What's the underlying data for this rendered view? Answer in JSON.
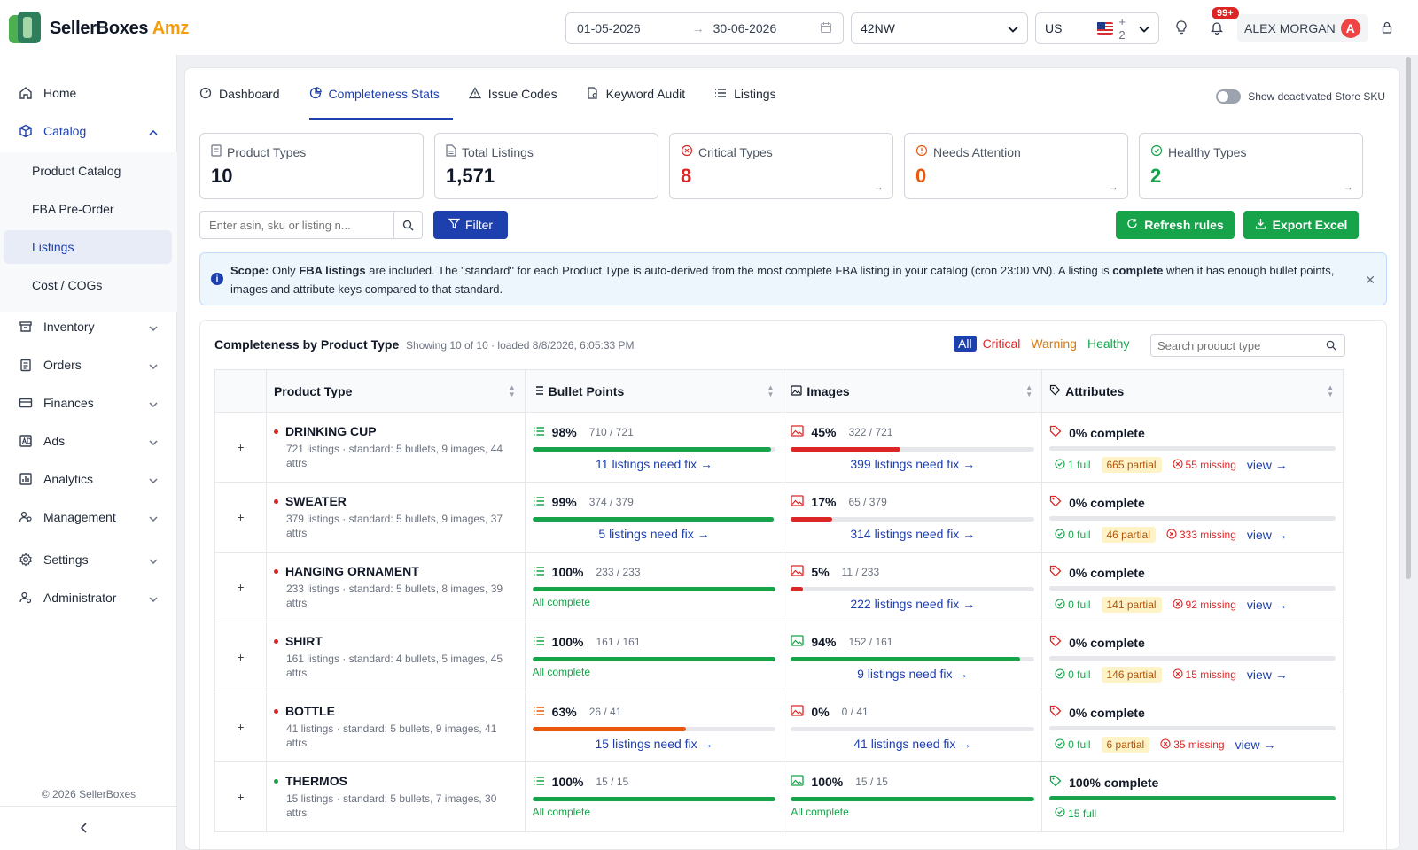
{
  "header": {
    "brand": "SellerBoxes",
    "brand_accent": "Amz",
    "date_from": "01-05-2026",
    "date_to": "30-06-2026",
    "store": "42NW",
    "market": "US",
    "market_extra": "+ 2",
    "notif_count": "99+",
    "user_name": "ALEX MORGAN",
    "user_initial": "A"
  },
  "sidebar": {
    "items": [
      {
        "label": "Home",
        "icon": "home-icon"
      },
      {
        "label": "Catalog",
        "icon": "box-icon"
      },
      {
        "label": "Inventory",
        "icon": "archive-icon"
      },
      {
        "label": "Orders",
        "icon": "clipboard-icon"
      },
      {
        "label": "Finances",
        "icon": "card-icon"
      },
      {
        "label": "Ads",
        "icon": "ad-icon"
      },
      {
        "label": "Analytics",
        "icon": "chart-icon"
      },
      {
        "label": "Management",
        "icon": "users-icon"
      },
      {
        "label": "Settings",
        "icon": "gear-icon"
      },
      {
        "label": "Administrator",
        "icon": "admin-icon"
      }
    ],
    "catalog_sub": [
      "Product Catalog",
      "FBA Pre-Order",
      "Listings",
      "Cost / COGs"
    ],
    "copyright": "© 2026 SellerBoxes"
  },
  "tabs": [
    "Dashboard",
    "Completeness Stats",
    "Issue Codes",
    "Keyword Audit",
    "Listings"
  ],
  "toggle_label": "Show deactivated Store SKU",
  "stats": [
    {
      "label": "Product Types",
      "value": "10",
      "color": "#111827"
    },
    {
      "label": "Total Listings",
      "value": "1,571",
      "color": "#111827"
    },
    {
      "label": "Critical Types",
      "value": "8",
      "color": "#dc2626"
    },
    {
      "label": "Needs Attention",
      "value": "0",
      "color": "#ea580c"
    },
    {
      "label": "Healthy Types",
      "value": "2",
      "color": "#16a34a"
    }
  ],
  "toolbar": {
    "search_placeholder": "Enter asin, sku or listing n...",
    "filter_label": "Filter",
    "refresh_label": "Refresh rules",
    "export_label": "Export Excel"
  },
  "info": {
    "scope_label": "Scope:",
    "t1": " Only ",
    "fba": "FBA listings",
    "t2": " are included. The \"standard\" for each Product Type is auto-derived from the most complete FBA listing in your catalog (cron 23:00 VN). A listing is ",
    "complete": "complete",
    "t3": " when it has enough bullet points, images and attribute keys compared to that standard."
  },
  "table_card": {
    "title": "Completeness by Product Type",
    "subtitle": "Showing 10 of 10 · loaded 8/8/2026, 6:05:33 PM",
    "filters": [
      "All",
      "Critical",
      "Warning",
      "Healthy"
    ],
    "search_placeholder": "Search product type",
    "columns": [
      "Product Type",
      "Bullet Points",
      "Images",
      "Attributes"
    ]
  },
  "rows": [
    {
      "name": "DRINKING CUP",
      "status": "critical",
      "meta": "721 listings · standard: 5 bullets, 9 images, 44 attrs",
      "bp": {
        "pct": "98%",
        "cnt": "710 / 721",
        "fill": 0.98,
        "state": "ok",
        "fix": "11 listings need fix →"
      },
      "img": {
        "pct": "45%",
        "cnt": "322 / 721",
        "fill": 0.45,
        "state": "bad",
        "fix": "399 listings need fix →"
      },
      "attr": {
        "pct": "0% complete",
        "fill": 0,
        "full": "1 full",
        "partial": "665 partial",
        "missing": "55 missing",
        "view": "view →"
      }
    },
    {
      "name": "SWEATER",
      "status": "critical",
      "meta": "379 listings · standard: 5 bullets, 9 images, 37 attrs",
      "bp": {
        "pct": "99%",
        "cnt": "374 / 379",
        "fill": 0.99,
        "state": "ok",
        "fix": "5 listings need fix →"
      },
      "img": {
        "pct": "17%",
        "cnt": "65 / 379",
        "fill": 0.17,
        "state": "bad",
        "fix": "314 listings need fix →"
      },
      "attr": {
        "pct": "0% complete",
        "fill": 0,
        "full": "0 full",
        "partial": "46 partial",
        "missing": "333 missing",
        "view": "view →"
      }
    },
    {
      "name": "HANGING ORNAMENT",
      "status": "critical",
      "meta": "233 listings · standard: 5 bullets, 8 images, 39 attrs",
      "bp": {
        "pct": "100%",
        "cnt": "233 / 233",
        "fill": 1,
        "state": "ok",
        "fix": "",
        "all": "All complete"
      },
      "img": {
        "pct": "5%",
        "cnt": "11 / 233",
        "fill": 0.05,
        "state": "bad",
        "fix": "222 listings need fix →"
      },
      "attr": {
        "pct": "0% complete",
        "fill": 0,
        "full": "0 full",
        "partial": "141 partial",
        "missing": "92 missing",
        "view": "view →"
      }
    },
    {
      "name": "SHIRT",
      "status": "critical",
      "meta": "161 listings · standard: 4 bullets, 5 images, 45 attrs",
      "bp": {
        "pct": "100%",
        "cnt": "161 / 161",
        "fill": 1,
        "state": "ok",
        "fix": "",
        "all": "All complete"
      },
      "img": {
        "pct": "94%",
        "cnt": "152 / 161",
        "fill": 0.94,
        "state": "ok",
        "fix": "9 listings need fix →"
      },
      "attr": {
        "pct": "0% complete",
        "fill": 0,
        "full": "0 full",
        "partial": "146 partial",
        "missing": "15 missing",
        "view": "view →"
      }
    },
    {
      "name": "BOTTLE",
      "status": "critical",
      "meta": "41 listings · standard: 5 bullets, 9 images, 41 attrs",
      "bp": {
        "pct": "63%",
        "cnt": "26 / 41",
        "fill": 0.63,
        "state": "warn",
        "fix": "15 listings need fix →"
      },
      "img": {
        "pct": "0%",
        "cnt": "0 / 41",
        "fill": 0,
        "state": "bad",
        "fix": "41 listings need fix →"
      },
      "attr": {
        "pct": "0% complete",
        "fill": 0,
        "full": "0 full",
        "partial": "6 partial",
        "missing": "35 missing",
        "view": "view →"
      }
    },
    {
      "name": "THERMOS",
      "status": "healthy",
      "meta": "15 listings · standard: 5 bullets, 7 images, 30 attrs",
      "bp": {
        "pct": "100%",
        "cnt": "15 / 15",
        "fill": 1,
        "state": "ok",
        "fix": "",
        "all": "All complete"
      },
      "img": {
        "pct": "100%",
        "cnt": "15 / 15",
        "fill": 1,
        "state": "ok",
        "fix": "",
        "all": "All complete"
      },
      "attr": {
        "pct": "100% complete",
        "fill": 1,
        "full": "15 full",
        "partial": "",
        "missing": "",
        "view": ""
      }
    }
  ],
  "colors": {
    "primary": "#1e40af",
    "success": "#16a34a",
    "danger": "#dc2626",
    "warning": "#ea580c"
  }
}
